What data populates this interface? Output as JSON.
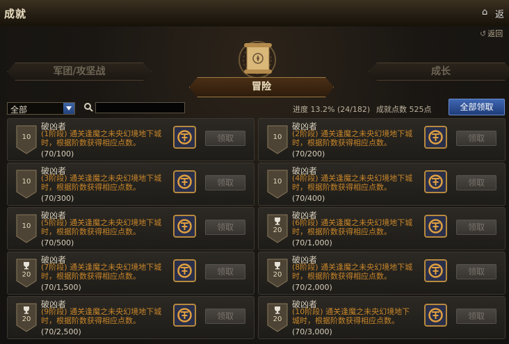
{
  "window": {
    "title": "成就",
    "top_right_label": "返"
  },
  "header": {
    "back_label": "返回",
    "tabs": [
      {
        "label": "军团/攻坚战",
        "active": false
      },
      {
        "label": "冒险",
        "active": true
      },
      {
        "label": "成长",
        "active": false
      }
    ]
  },
  "toolbar": {
    "filter_value": "全部",
    "search_value": "",
    "progress_label": "进度",
    "progress_value": "13.2% (24/182)",
    "points_label": "成就点数",
    "points_value": "525点",
    "claim_all_label": "全部领取"
  },
  "colors": {
    "accent": "#2f5aa8",
    "desc": "#c8862a",
    "active_tab": "#4a2f15"
  },
  "achievements": [
    {
      "name": "破凶者",
      "desc": "(1阶段) 通关逢魔之未央幻境地下城时，根据阶数获得相应点数。",
      "progress": "(70/100)",
      "points": "10",
      "trophy": false,
      "claim_label": "领取"
    },
    {
      "name": "破凶者",
      "desc": "(2阶段) 通关逢魔之未央幻境地下城时，根据阶数获得相应点数。",
      "progress": "(70/200)",
      "points": "10",
      "trophy": false,
      "claim_label": "领取"
    },
    {
      "name": "破凶者",
      "desc": "(3阶段) 通关逢魔之未央幻境地下城时，根据阶数获得相应点数。",
      "progress": "(70/300)",
      "points": "10",
      "trophy": false,
      "claim_label": "领取"
    },
    {
      "name": "破凶者",
      "desc": "(4阶段) 通关逢魔之未央幻境地下城时，根据阶数获得相应点数。",
      "progress": "(70/400)",
      "points": "10",
      "trophy": false,
      "claim_label": "领取"
    },
    {
      "name": "破凶者",
      "desc": "(5阶段) 通关逢魔之未央幻境地下城时，根据阶数获得相应点数。",
      "progress": "(70/500)",
      "points": "10",
      "trophy": false,
      "claim_label": "领取"
    },
    {
      "name": "破凶者",
      "desc": "(6阶段) 通关逢魔之未央幻境地下城时，根据阶数获得相应点数。",
      "progress": "(70/1,000)",
      "points": "20",
      "trophy": true,
      "claim_label": "领取"
    },
    {
      "name": "破凶者",
      "desc": "(7阶段) 通关逢魔之未央幻境地下城时，根据阶数获得相应点数。",
      "progress": "(70/1,500)",
      "points": "20",
      "trophy": true,
      "claim_label": "领取"
    },
    {
      "name": "破凶者",
      "desc": "(8阶段) 通关逢魔之未央幻境地下城时，根据阶数获得相应点数。",
      "progress": "(70/2,000)",
      "points": "20",
      "trophy": true,
      "claim_label": "领取"
    },
    {
      "name": "破凶者",
      "desc": "(9阶段) 通关逢魔之未央幻境地下城时，根据阶数获得相应点数。",
      "progress": "(70/2,500)",
      "points": "20",
      "trophy": true,
      "claim_label": "领取"
    },
    {
      "name": "破凶者",
      "desc": "(10阶段) 通关逢魔之未央幻境地下城时，根据阶数获得相应点数。",
      "progress": "(70/3,000)",
      "points": "20",
      "trophy": true,
      "claim_label": "领取"
    }
  ]
}
